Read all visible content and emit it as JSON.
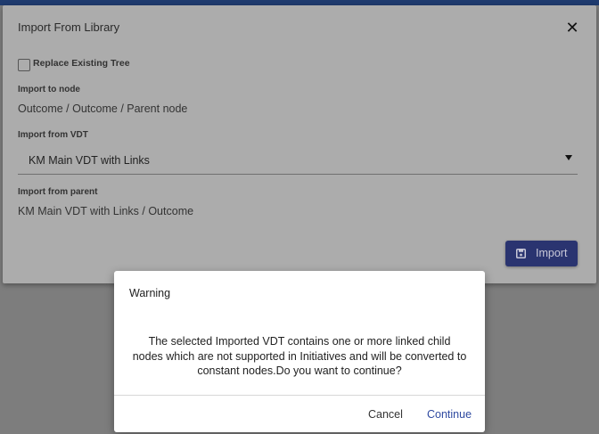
{
  "import_dialog": {
    "title": "Import From Library",
    "close_glyph": "✕",
    "replace_label": "Replace Existing Tree",
    "replace_checked": false,
    "import_to_node_label": "Import to node",
    "import_to_node_path": "Outcome / Outcome / Parent node",
    "import_from_vdt_label": "Import from VDT",
    "import_from_vdt_value": "KM Main VDT with Links",
    "import_from_parent_label": "Import from parent",
    "import_from_parent_path": "KM Main VDT with Links / Outcome",
    "import_button_label": "Import",
    "import_button_icon": "save-icon"
  },
  "warning_dialog": {
    "title": "Warning",
    "message": "The selected Imported VDT contains one or more linked child nodes which are not supported in Initiatives and will be converted to constant nodes.Do you want to continue?",
    "cancel_label": "Cancel",
    "continue_label": "Continue"
  },
  "colors": {
    "primary": "#2a3470",
    "link": "#2f4aa0",
    "header": "#1f3b6e"
  }
}
